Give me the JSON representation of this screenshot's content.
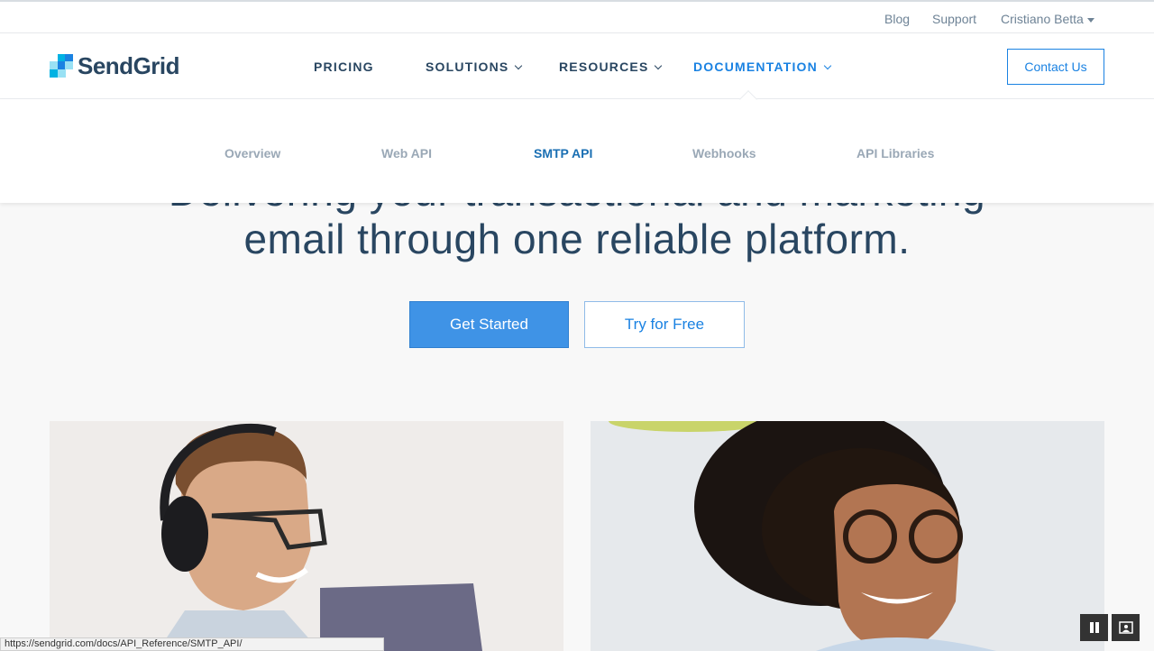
{
  "topbar": {
    "blog": "Blog",
    "support": "Support",
    "user": "Cristiano Betta"
  },
  "brand": {
    "name": "SendGrid",
    "accent": "#1a82e2",
    "navy": "#294661"
  },
  "nav": {
    "pricing": "PRICING",
    "solutions": "SOLUTIONS",
    "resources": "RESOURCES",
    "documentation": "DOCUMENTATION",
    "contact": "Contact Us"
  },
  "subnav": {
    "overview": "Overview",
    "web_api": "Web API",
    "smtp_api": "SMTP API",
    "webhooks": "Webhooks",
    "api_libraries": "API Libraries"
  },
  "hero": {
    "line1": "Delivering your transactional and marketing",
    "line2": "email through one reliable platform.",
    "primary_cta": "Get Started",
    "secondary_cta": "Try for Free"
  },
  "status_url": "https://sendgrid.com/docs/API_Reference/SMTP_API/"
}
